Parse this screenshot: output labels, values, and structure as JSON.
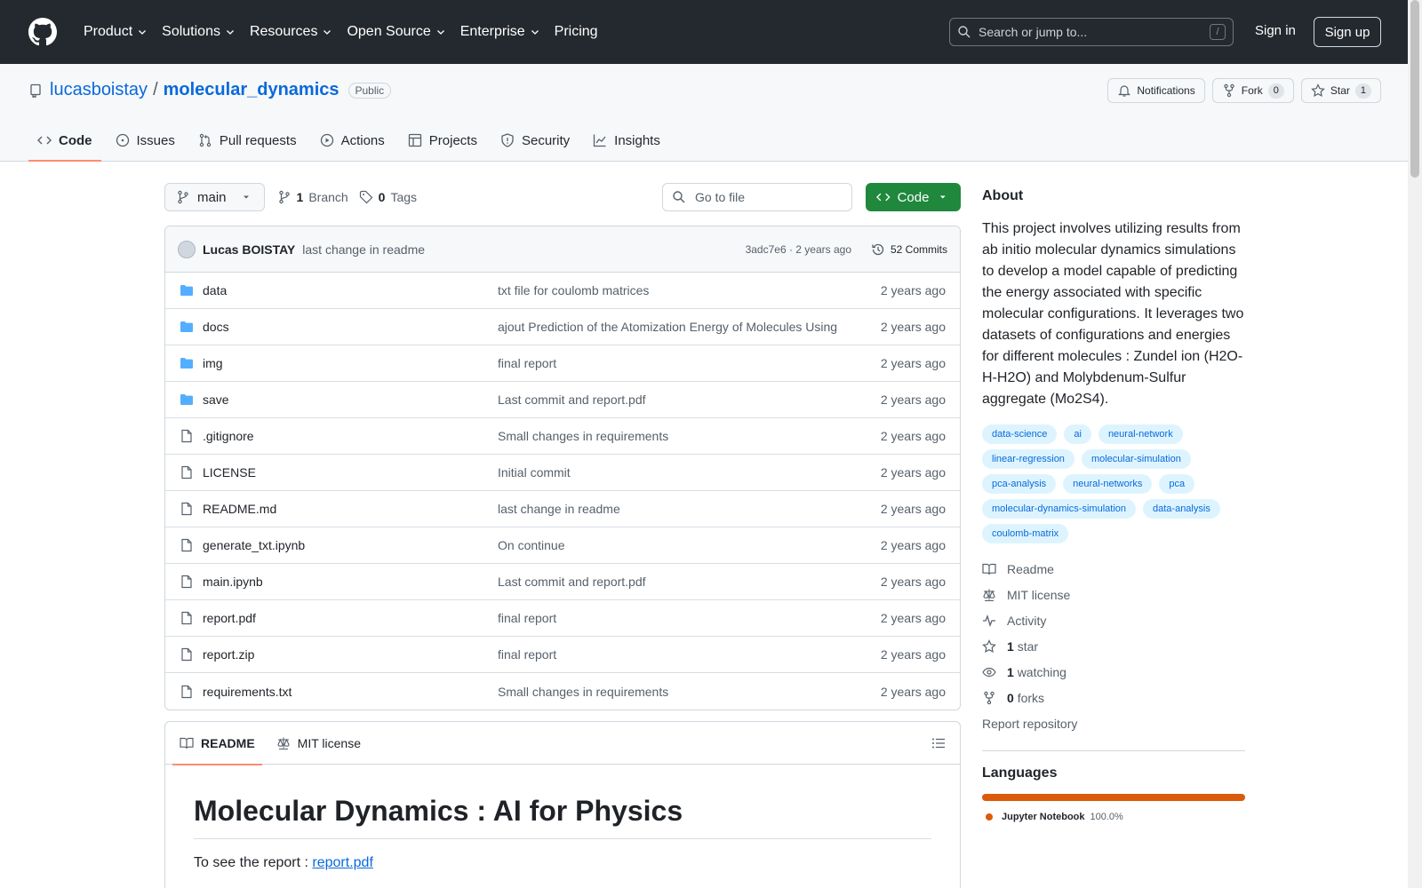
{
  "header": {
    "nav": [
      "Product",
      "Solutions",
      "Resources",
      "Open Source",
      "Enterprise",
      "Pricing"
    ],
    "search_placeholder": "Search or jump to...",
    "search_shortcut": "/",
    "sign_in": "Sign in",
    "sign_up": "Sign up"
  },
  "repo": {
    "owner": "lucasboistay",
    "separator": "/",
    "name": "molecular_dynamics",
    "visibility": "Public",
    "notifications_label": "Notifications",
    "fork_label": "Fork",
    "fork_count": "0",
    "star_label": "Star",
    "star_count": "1"
  },
  "tabs": [
    "Code",
    "Issues",
    "Pull requests",
    "Actions",
    "Projects",
    "Security",
    "Insights"
  ],
  "toolbar": {
    "branch": "main",
    "branch_count": "1",
    "branch_label": "Branch",
    "tag_count": "0",
    "tag_label": "Tags",
    "goto_file": "Go to file",
    "code_button": "Code"
  },
  "commit": {
    "author": "Lucas BOISTAY",
    "message": "last change in readme",
    "hash_age": "3adc7e6 · 2 years ago",
    "commits": "52 Commits"
  },
  "files": [
    {
      "name": "data",
      "type": "dir",
      "message": "txt file for coulomb matrices",
      "age": "2 years ago"
    },
    {
      "name": "docs",
      "type": "dir",
      "message": "ajout Prediction of the Atomization Energy of Molecules Using",
      "age": "2 years ago"
    },
    {
      "name": "img",
      "type": "dir",
      "message": "final report",
      "age": "2 years ago"
    },
    {
      "name": "save",
      "type": "dir",
      "message": "Last commit and report.pdf",
      "age": "2 years ago"
    },
    {
      "name": ".gitignore",
      "type": "file",
      "message": "Small changes in requirements",
      "age": "2 years ago"
    },
    {
      "name": "LICENSE",
      "type": "file",
      "message": "Initial commit",
      "age": "2 years ago"
    },
    {
      "name": "README.md",
      "type": "file",
      "message": "last change in readme",
      "age": "2 years ago"
    },
    {
      "name": "generate_txt.ipynb",
      "type": "file",
      "message": "On continue",
      "age": "2 years ago"
    },
    {
      "name": "main.ipynb",
      "type": "file",
      "message": "Last commit and report.pdf",
      "age": "2 years ago"
    },
    {
      "name": "report.pdf",
      "type": "file",
      "message": "final report",
      "age": "2 years ago"
    },
    {
      "name": "report.zip",
      "type": "file",
      "message": "final report",
      "age": "2 years ago"
    },
    {
      "name": "requirements.txt",
      "type": "file",
      "message": "Small changes in requirements",
      "age": "2 years ago"
    }
  ],
  "readme": {
    "tab_readme": "README",
    "tab_license": "MIT license",
    "title": "Molecular Dynamics : AI for Physics",
    "para_prefix": "To see the report : ",
    "para_link": "report.pdf"
  },
  "sidebar": {
    "about_heading": "About",
    "description": "This project involves utilizing results from ab initio molecular dynamics simulations to develop a model capable of predicting the energy associated with specific molecular configurations. It leverages two datasets of configurations and energies for different molecules : Zundel ion (H2O-H-H2O) and Molybdenum-Sulfur aggregate (Mo2S4).",
    "topics": [
      "data-science",
      "ai",
      "neural-network",
      "linear-regression",
      "molecular-simulation",
      "pca-analysis",
      "neural-networks",
      "pca",
      "molecular-dynamics-simulation",
      "data-analysis",
      "coulomb-matrix"
    ],
    "readme": "Readme",
    "license": "MIT license",
    "activity": "Activity",
    "stars_count": "1",
    "stars_label": "star",
    "watching_count": "1",
    "watching_label": "watching",
    "forks_count": "0",
    "forks_label": "forks",
    "report": "Report repository",
    "languages_heading": "Languages",
    "language": "Jupyter Notebook",
    "language_pct": "100.0%",
    "language_fraction": 1.0,
    "language_color": "#da5b0b"
  }
}
